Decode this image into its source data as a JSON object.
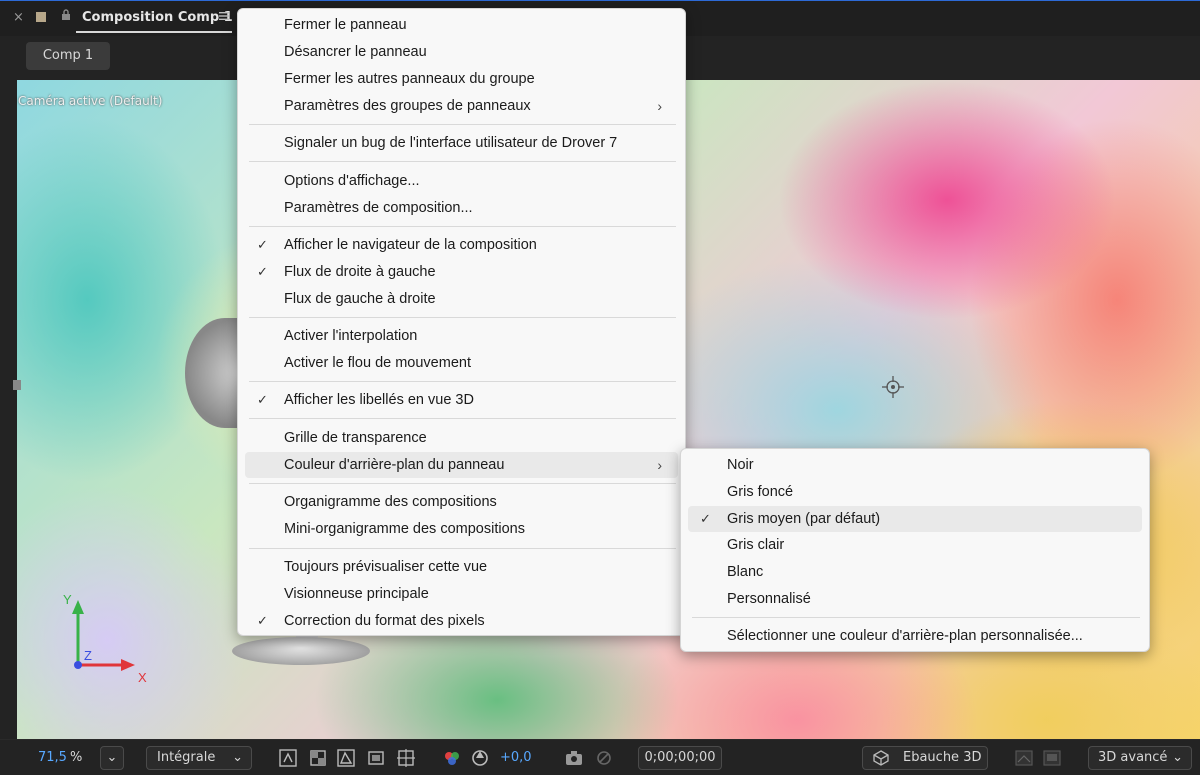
{
  "panel": {
    "close": "×",
    "tab_title": "Composition Comp 1",
    "comp_button": "Comp 1"
  },
  "viewer": {
    "camera_label": "Caméra active (Default)",
    "axis_y": "Y",
    "axis_z": "Z",
    "axis_x": "X"
  },
  "toolbar": {
    "zoom_value": "71,5",
    "zoom_unit": "%",
    "resolution": "Intégrale",
    "exposure": "+0,0",
    "timecode": "0;00;00;00",
    "draft3d": "Ebauche 3D",
    "renderer": "3D avancé"
  },
  "context_menu": {
    "items": [
      {
        "label": "Fermer le panneau",
        "checked": false,
        "submenu": false
      },
      {
        "label": "Désancrer le panneau",
        "checked": false,
        "submenu": false
      },
      {
        "label": "Fermer les autres panneaux du groupe",
        "checked": false,
        "submenu": false
      },
      {
        "label": "Paramètres des groupes de panneaux",
        "checked": false,
        "submenu": true
      },
      {
        "label": "Signaler un bug de l'interface utilisateur de Drover 7",
        "checked": false,
        "submenu": false
      },
      {
        "label": "Options d'affichage...",
        "checked": false,
        "submenu": false
      },
      {
        "label": "Paramètres de composition...",
        "checked": false,
        "submenu": false
      },
      {
        "label": "Afficher le navigateur de la composition",
        "checked": true,
        "submenu": false
      },
      {
        "label": "Flux de droite à gauche",
        "checked": true,
        "submenu": false
      },
      {
        "label": "Flux de gauche à droite",
        "checked": false,
        "submenu": false
      },
      {
        "label": "Activer l'interpolation",
        "checked": false,
        "submenu": false
      },
      {
        "label": "Activer le flou de mouvement",
        "checked": false,
        "submenu": false
      },
      {
        "label": "Afficher les libellés en vue 3D",
        "checked": true,
        "submenu": false
      },
      {
        "label": "Grille de transparence",
        "checked": false,
        "submenu": false
      },
      {
        "label": "Couleur d'arrière-plan du panneau",
        "checked": false,
        "submenu": true
      },
      {
        "label": "Organigramme des compositions",
        "checked": false,
        "submenu": false
      },
      {
        "label": "Mini-organigramme des compositions",
        "checked": false,
        "submenu": false
      },
      {
        "label": "Toujours prévisualiser cette vue",
        "checked": false,
        "submenu": false
      },
      {
        "label": "Visionneuse principale",
        "checked": false,
        "submenu": false
      },
      {
        "label": "Correction du format des pixels",
        "checked": true,
        "submenu": false
      }
    ]
  },
  "submenu": {
    "items": [
      {
        "label": "Noir",
        "checked": false
      },
      {
        "label": "Gris foncé",
        "checked": false
      },
      {
        "label": "Gris moyen (par défaut)",
        "checked": true
      },
      {
        "label": "Gris clair",
        "checked": false
      },
      {
        "label": "Blanc",
        "checked": false
      },
      {
        "label": "Personnalisé",
        "checked": false
      },
      {
        "label": "Sélectionner une couleur d'arrière-plan personnalisée...",
        "checked": false
      }
    ]
  },
  "glyphs": {
    "check": "✓",
    "chevron": "›"
  }
}
